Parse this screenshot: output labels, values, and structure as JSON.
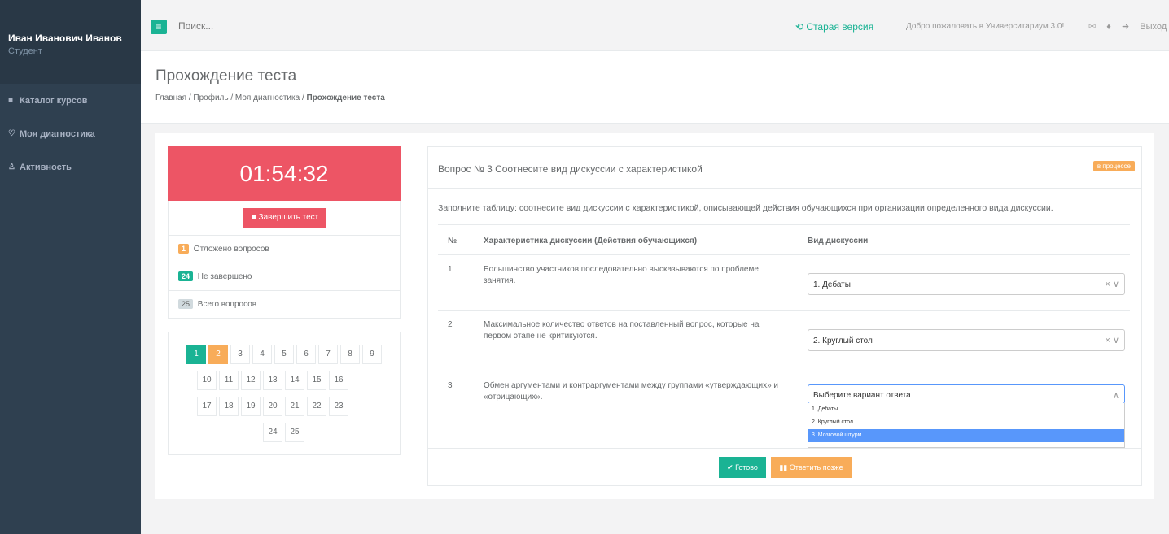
{
  "user": {
    "name": "Иван Иванович Иванов",
    "role": "Студент"
  },
  "sidebar": {
    "items": [
      {
        "label": "Каталог курсов",
        "icon": "■"
      },
      {
        "label": "Моя диагностика",
        "icon": "♡"
      },
      {
        "label": "Активность",
        "icon": "♙"
      }
    ]
  },
  "topbar": {
    "menu_icon": "≡",
    "search_placeholder": "Поиск...",
    "old_version": "Старая версия",
    "old_version_icon": "⟲",
    "welcome": "Добро пожаловать в Университариум 3.0!",
    "mail_icon": "✉",
    "bell_icon": "♦",
    "logout_icon": "➜",
    "logout": "Выход"
  },
  "header": {
    "title": "Прохождение теста",
    "breadcrumb": [
      "Главная",
      "Профиль",
      "Моя диагностика",
      "Прохождение теста"
    ],
    "sep": "/"
  },
  "test_panel": {
    "timer": "01:54:32",
    "finish_label": "Завершить тест",
    "finish_icon": "■",
    "stats": [
      {
        "count": "1",
        "label": "Отложено вопросов",
        "color": "#f8ac59"
      },
      {
        "count": "24",
        "label": "Не завершено",
        "color": "#1ab394"
      },
      {
        "count": "25",
        "label": "Всего вопросов",
        "color": "#d1dade"
      }
    ],
    "pages": [
      "1",
      "2",
      "3",
      "4",
      "5",
      "6",
      "7",
      "8",
      "9",
      "10",
      "11",
      "12",
      "13",
      "14",
      "15",
      "16",
      "17",
      "18",
      "19",
      "20",
      "21",
      "22",
      "23",
      "24",
      "25"
    ],
    "active_page": "1",
    "postponed_page": "2"
  },
  "question": {
    "title": "Вопрос № 3 Соотнесите вид дискуссии с характеристикой",
    "status": "в процессе",
    "intro": "Заполните таблицу: соотнесите вид дискуссии с характеристикой, описывающей действия обучающихся при организации определенного вида дискуссии.",
    "columns": [
      "№",
      "Характеристика дискуссии (Действия обучающихся)",
      "Вид дискуссии"
    ],
    "rows": [
      {
        "num": "1",
        "text": "Большинство участников последовательно высказываются по проблеме занятия.",
        "answer": "1. Дебаты"
      },
      {
        "num": "2",
        "text": "Максимальное количество ответов на поставленный вопрос, которые на первом этапе не критикуются.",
        "answer": "2. Круглый стол"
      },
      {
        "num": "3",
        "text": "Обмен аргументами и контраргументами между группами «утверждающих» и «отрицающих».",
        "answer": "Выберите вариант ответа"
      }
    ],
    "clear_icon": "×",
    "chevron_down": "∨",
    "chevron_up": "∧",
    "options": [
      "1. Дебаты",
      "2. Круглый стол",
      "3. Мозговой штурм"
    ],
    "highlighted_option": "3. Мозговой штурм",
    "done_label": "Готово",
    "done_icon": "✔",
    "later_label": "Ответить позже",
    "later_icon": "▮▮"
  }
}
